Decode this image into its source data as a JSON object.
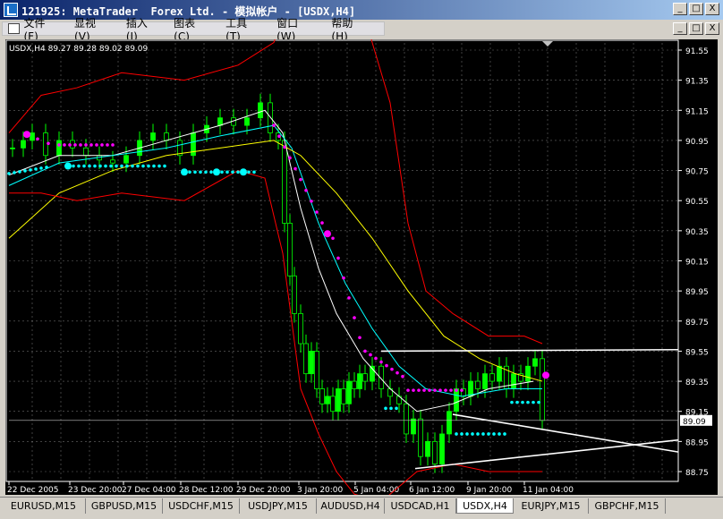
{
  "window": {
    "title": "121925: MetaTrader  Forex Ltd. - 模拟帐户 - [USDX,H4]",
    "minimize": "_",
    "maximize": "□",
    "close": "X"
  },
  "menu": {
    "items": [
      "文件(F)",
      "显视(V)",
      "插入(I)",
      "图表(C)",
      "工具(T)",
      "窗口(W)",
      "帮助(H)"
    ],
    "doc_buttons": [
      "_",
      "□",
      "X"
    ]
  },
  "chart": {
    "header": "USDX,H4  89.27 89.28 89.02 89.09",
    "current_price": "89.09",
    "price_labels": [
      "91.55",
      "91.35",
      "91.15",
      "90.95",
      "90.75",
      "90.55",
      "90.35",
      "90.15",
      "89.95",
      "89.75",
      "89.55",
      "89.35",
      "89.15",
      "88.95",
      "88.75"
    ],
    "time_labels": [
      "22 Dec 2005",
      "23 Dec 20:00",
      "27 Dec 04:00",
      "28 Dec 12:00",
      "29 Dec 20:00",
      "3 Jan 20:00",
      "5 Jan 04:00",
      "6 Jan 12:00",
      "9 Jan 20:00",
      "11 Jan 04:00"
    ],
    "colors": {
      "background": "#000000",
      "grid": "#c0c0c0",
      "bull_candle": "#00ff00",
      "bear_candle_fill": "#000000",
      "bear_candle_stroke": "#00ff00",
      "bollinger": "#ff0000",
      "ma_fast": "#ffffff",
      "ma_mid": "#00ffff",
      "ma_slow": "#ffff00",
      "magenta_dots": "#ff00ff",
      "cyan_dots": "#00ffff",
      "trendlines": "#ffffff",
      "axis_text": "#ffffff"
    }
  },
  "tabs": [
    "EURUSD,M15",
    "GBPUSD,M15",
    "USDCHF,M15",
    "USDJPY,M15",
    "AUDUSD,H4",
    "USDCAD,H1",
    "USDX,H4",
    "EURJPY,M15",
    "GBPCHF,M15"
  ],
  "active_tab": "USDX,H4"
}
